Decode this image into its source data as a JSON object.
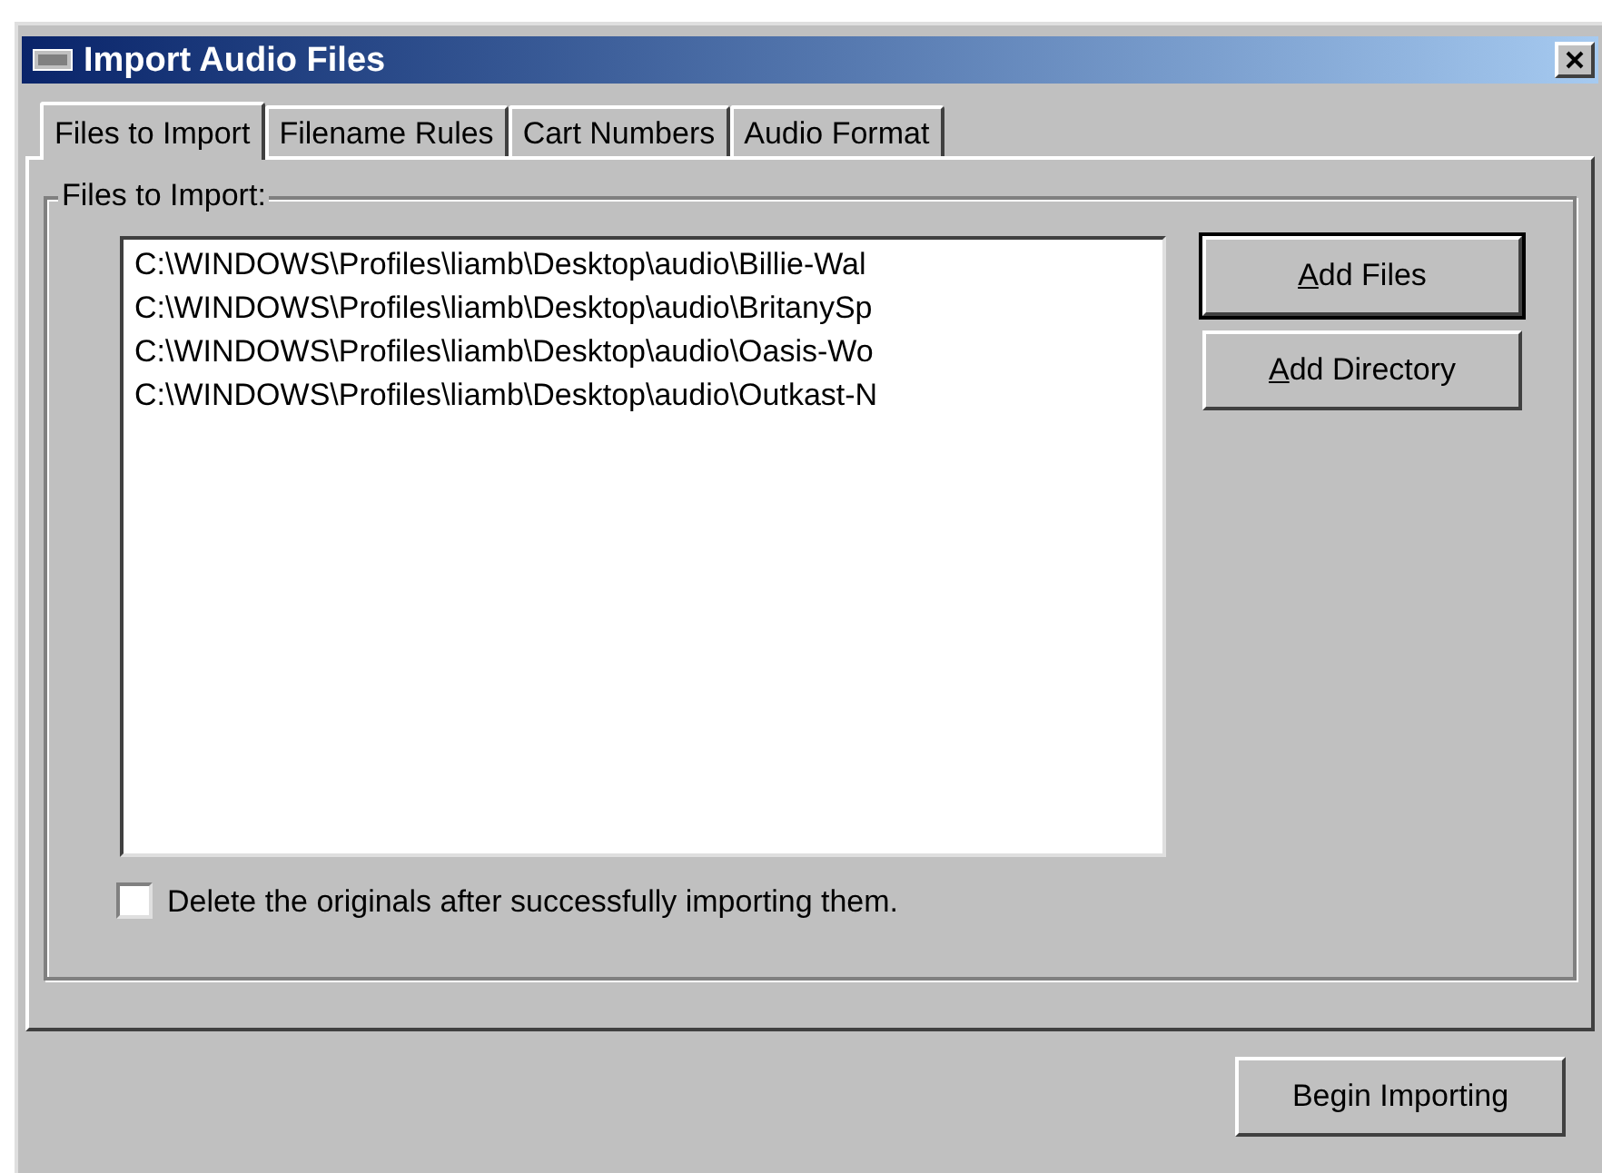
{
  "window": {
    "title": "Import Audio Files"
  },
  "tabs": [
    {
      "label": "Files to Import",
      "selected": true
    },
    {
      "label": "Filename Rules",
      "selected": false
    },
    {
      "label": "Cart Numbers",
      "selected": false
    },
    {
      "label": "Audio Format",
      "selected": false
    }
  ],
  "group": {
    "label": "Files to Import:"
  },
  "files": [
    {
      "path": "C:\\WINDOWS\\Profiles\\liamb\\Desktop\\audio\\Billie-Wal",
      "selected": false
    },
    {
      "path": "C:\\WINDOWS\\Profiles\\liamb\\Desktop\\audio\\BritanySp",
      "selected": false
    },
    {
      "path": "C:\\WINDOWS\\Profiles\\liamb\\Desktop\\audio\\Oasis-Wo",
      "selected": false
    },
    {
      "path": "C:\\WINDOWS\\Profiles\\liamb\\Desktop\\audio\\Outkast-N",
      "selected": false
    }
  ],
  "side_buttons": [
    {
      "label": "Add Files",
      "first_letter_underlined": true,
      "default": true
    },
    {
      "label": "Add Directory",
      "first_letter_underlined": true,
      "default": false
    }
  ],
  "delete_originals": {
    "label": "Delete the originals after successfully importing them.",
    "checked": false
  },
  "begin_button": {
    "label": "Begin Importing"
  }
}
